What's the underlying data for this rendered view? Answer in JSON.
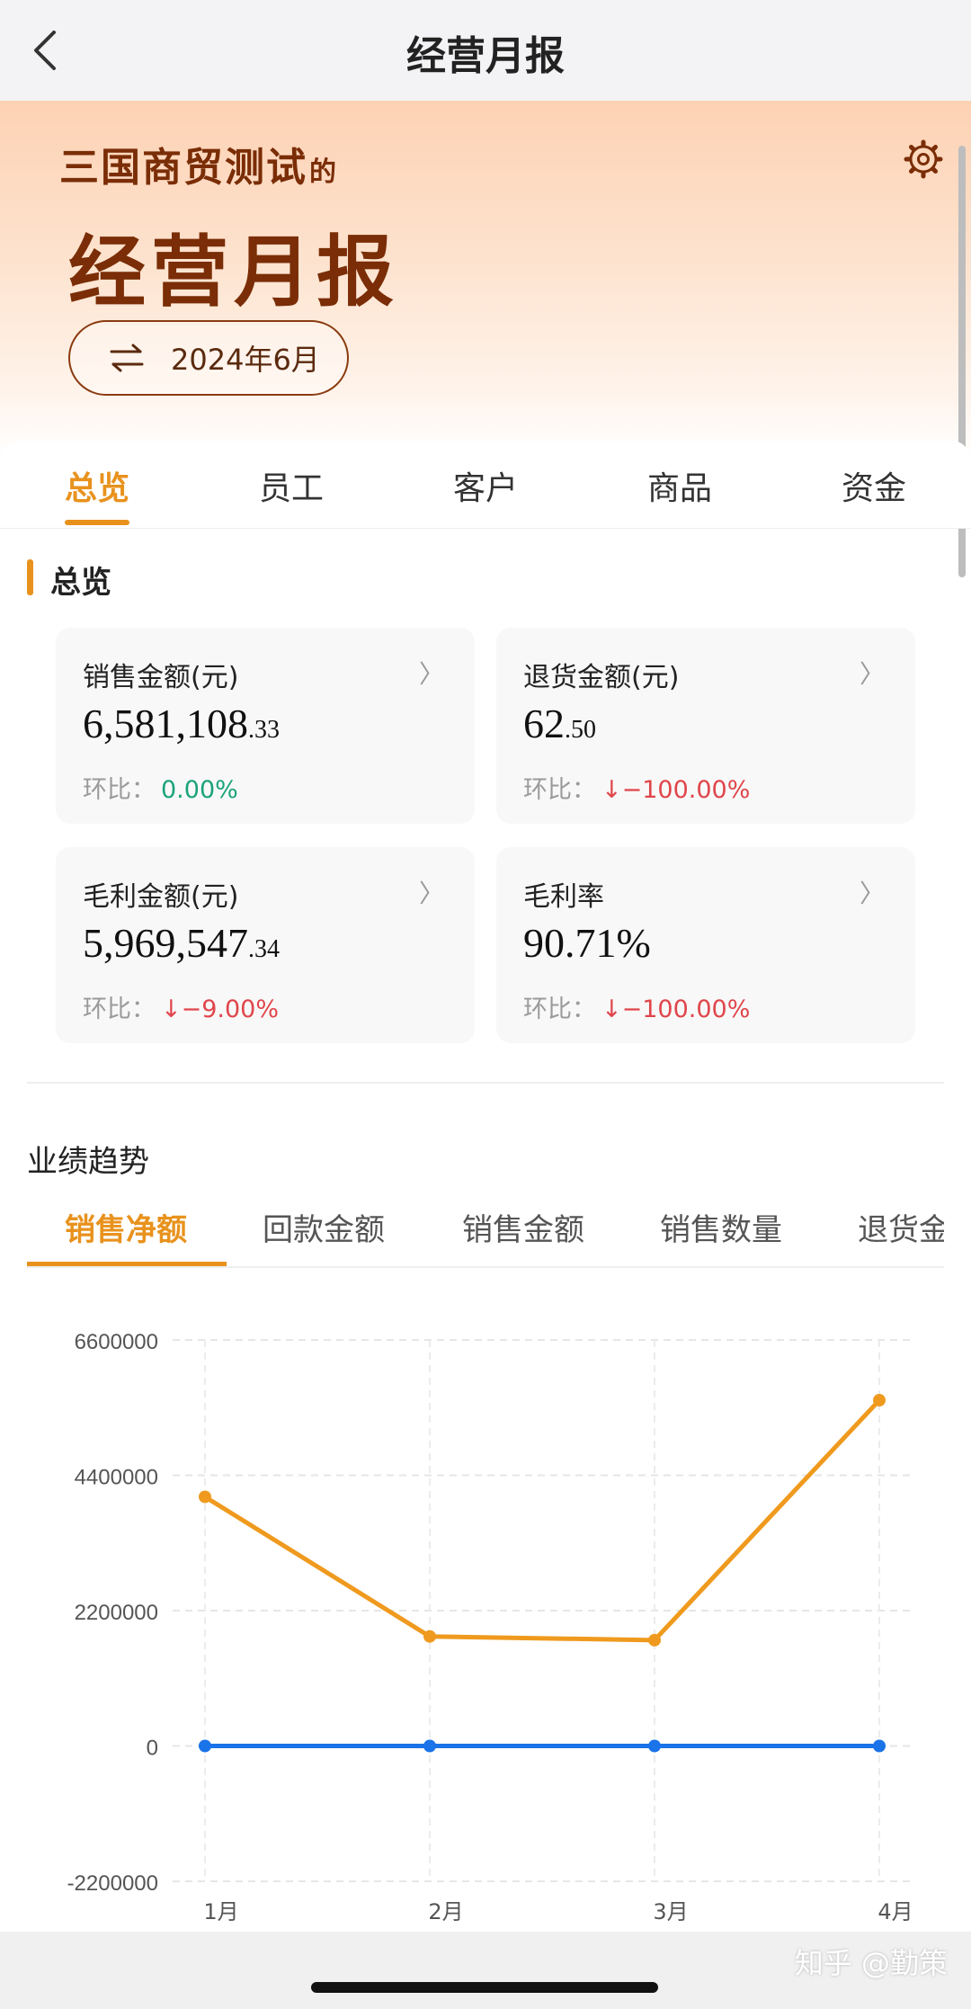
{
  "nav": {
    "title": "经营月报"
  },
  "hero": {
    "company": "三国商贸测试",
    "company_suffix": "的",
    "title": "经营月报",
    "month": "2024年6月"
  },
  "tabs": [
    "总览",
    "员工",
    "客户",
    "商品",
    "资金"
  ],
  "section": {
    "title": "总览"
  },
  "cards": [
    {
      "label": "销售金额(元)",
      "value_int": "6,581,108",
      "value_dec": ".33",
      "cmp_label": "环比：",
      "cmp_value": "0.00%",
      "trend": "flat"
    },
    {
      "label": "退货金额(元)",
      "value_int": "62",
      "value_dec": ".50",
      "cmp_label": "环比：",
      "cmp_value": "−100.00%",
      "trend": "down"
    },
    {
      "label": "毛利金额(元)",
      "value_int": "5,969,547",
      "value_dec": ".34",
      "cmp_label": "环比：",
      "cmp_value": "−9.00%",
      "trend": "down"
    },
    {
      "label": "毛利率",
      "value_int": "90.71%",
      "value_dec": "",
      "cmp_label": "环比：",
      "cmp_value": "−100.00%",
      "trend": "down"
    }
  ],
  "trend": {
    "title": "业绩趋势",
    "sub_tabs": [
      "销售净额",
      "回款金额",
      "销售金额",
      "销售数量",
      "退货金额"
    ]
  },
  "chart_data": {
    "type": "line",
    "categories": [
      "1月",
      "2月",
      "3月",
      "4月"
    ],
    "y_ticks": [
      "6600000",
      "4400000",
      "2200000",
      "0",
      "-2200000"
    ],
    "ylim": [
      -2200000,
      6600000
    ],
    "grid": true,
    "series": [
      {
        "color": "#ef9a1e",
        "values": [
          4050000,
          1780000,
          1720000,
          5620000
        ]
      },
      {
        "color": "#1a73e8",
        "values": [
          0,
          0,
          0,
          0
        ]
      }
    ]
  },
  "watermark": "知乎 @勤策",
  "colors": {
    "accent": "#e8921d",
    "brand_dark": "#7a2d06",
    "down": "#e0454b",
    "flat": "#1aa37a"
  }
}
